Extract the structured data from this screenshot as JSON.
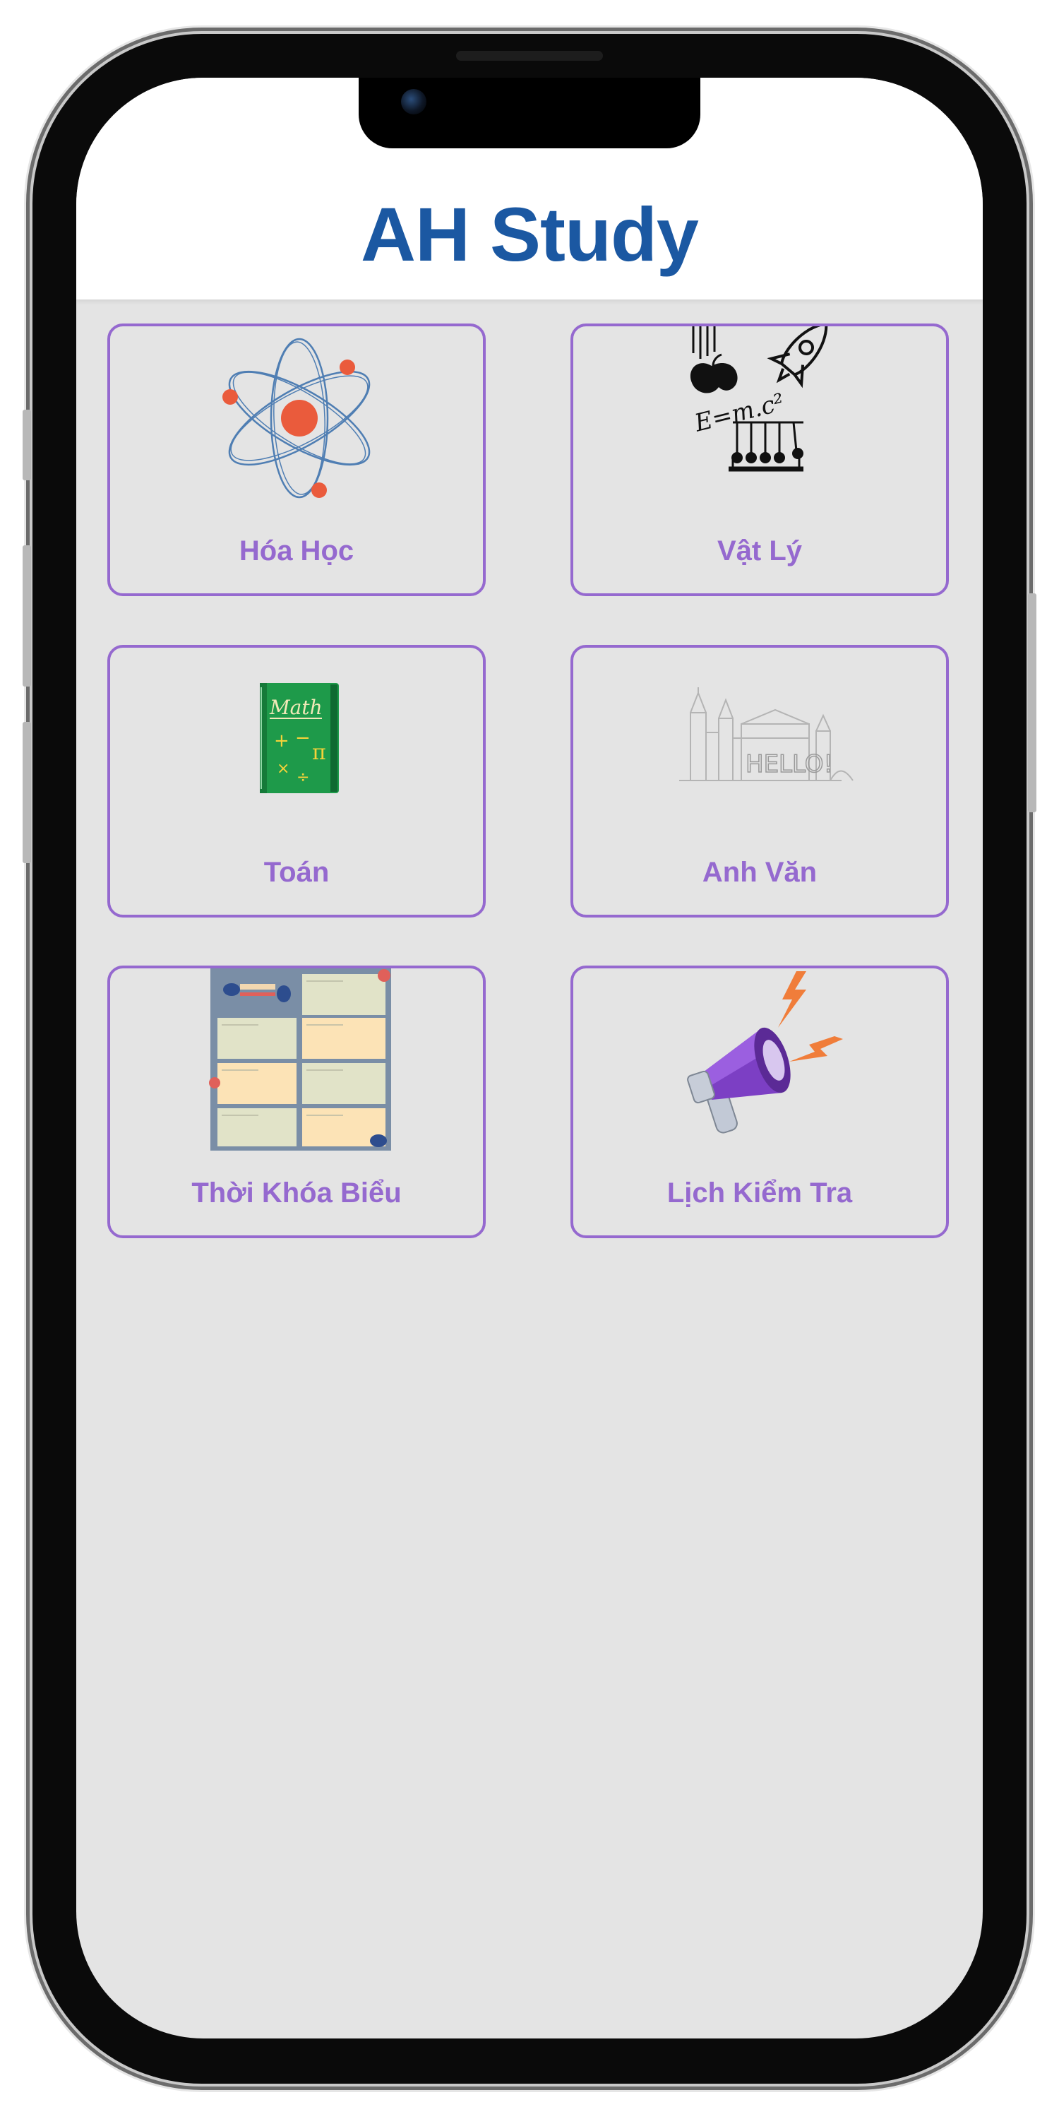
{
  "app": {
    "title": "AH Study"
  },
  "subjects": [
    {
      "label": "Hóa Học",
      "icon": "atom-icon"
    },
    {
      "label": "Vật Lý",
      "icon": "physics-icon"
    },
    {
      "label": "Toán",
      "icon": "math-book-icon"
    },
    {
      "label": "Anh Văn",
      "icon": "english-hello-icon"
    },
    {
      "label": "Thời Khóa Biểu",
      "icon": "weekly-timetable-icon"
    },
    {
      "label": "Lịch Kiểm Tra",
      "icon": "megaphone-icon"
    }
  ],
  "colors": {
    "title": "#1b58a2",
    "card_accent": "#9569cf",
    "background": "#e4e4e4",
    "header": "#ffffff"
  }
}
